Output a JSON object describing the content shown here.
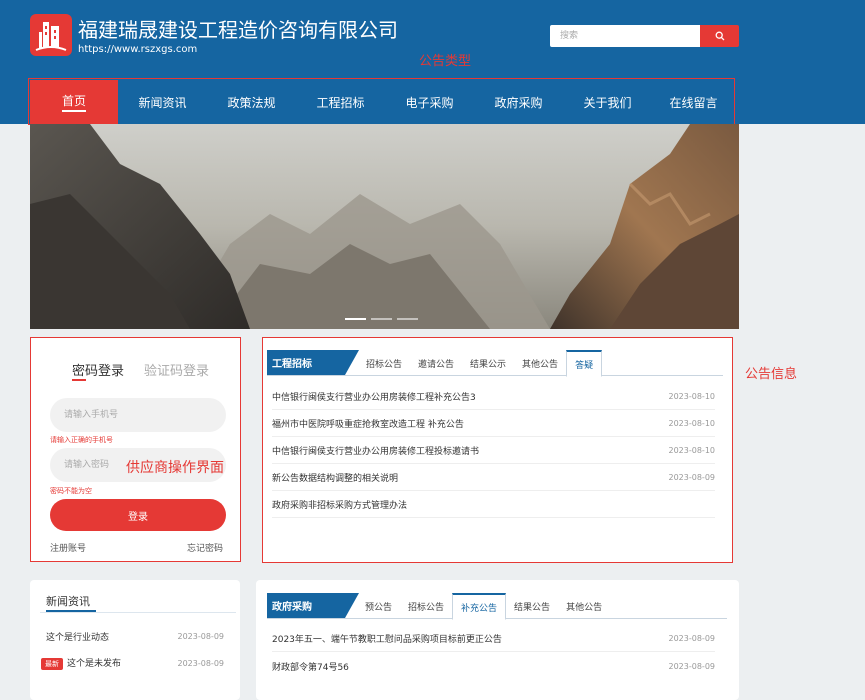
{
  "header": {
    "title": "福建瑞晟建设工程造价咨询有限公司",
    "url": "https://www.rszxgs.com",
    "search_placeholder": "搜索"
  },
  "annotations": {
    "type_label": "公告类型",
    "info_label": "公告信息",
    "supplier_label": "供应商操作界面"
  },
  "nav": {
    "items": [
      {
        "label": "首页",
        "active": true
      },
      {
        "label": "新闻资讯"
      },
      {
        "label": "政策法规"
      },
      {
        "label": "工程招标"
      },
      {
        "label": "电子采购"
      },
      {
        "label": "政府采购"
      },
      {
        "label": "关于我们"
      },
      {
        "label": "在线留言"
      }
    ]
  },
  "banner": {
    "slide_count": 3,
    "active_slide": 1
  },
  "login": {
    "tab_password": "密码登录",
    "tab_code": "验证码登录",
    "phone_placeholder": "请输入手机号",
    "phone_error": "请输入正确的手机号",
    "password_placeholder": "请输入密码",
    "password_error": "密码不能为空",
    "login_button": "登录",
    "register_link": "注册账号",
    "forgot_link": "忘记密码"
  },
  "engineering": {
    "title": "工程招标",
    "tabs": [
      "招标公告",
      "邀请公告",
      "结果公示",
      "其他公告",
      "答疑"
    ],
    "active_tab": 4,
    "rows": [
      {
        "title": "中信银行闽侯支行营业办公用房装修工程补充公告3",
        "date": "2023-08-10"
      },
      {
        "title": "福州市中医院呼吸重症抢救室改造工程 补充公告",
        "date": "2023-08-10"
      },
      {
        "title": "中信银行闽侯支行营业办公用房装修工程投标邀请书",
        "date": "2023-08-10"
      },
      {
        "title": "新公告数据结构调整的相关说明",
        "date": "2023-08-09"
      },
      {
        "title": "政府采购非招标采购方式管理办法",
        "date": ""
      }
    ]
  },
  "news": {
    "title": "新闻资讯",
    "rows": [
      {
        "title": "这个是行业动态",
        "date": "2023-08-09",
        "badge": ""
      },
      {
        "title": "这个是未发布",
        "date": "2023-08-09",
        "badge": "最新"
      }
    ]
  },
  "gov": {
    "title": "政府采购",
    "tabs": [
      "预公告",
      "招标公告",
      "补充公告",
      "结果公告",
      "其他公告"
    ],
    "active_tab": 2,
    "rows": [
      {
        "title": "2023年五一、端午节教职工慰问品采购项目标前更正公告",
        "date": "2023-08-09"
      },
      {
        "title": "财政部令第74号56",
        "date": "2023-08-09"
      }
    ]
  },
  "colors": {
    "brand_blue": "#1565a1",
    "accent_red": "#e53935"
  }
}
